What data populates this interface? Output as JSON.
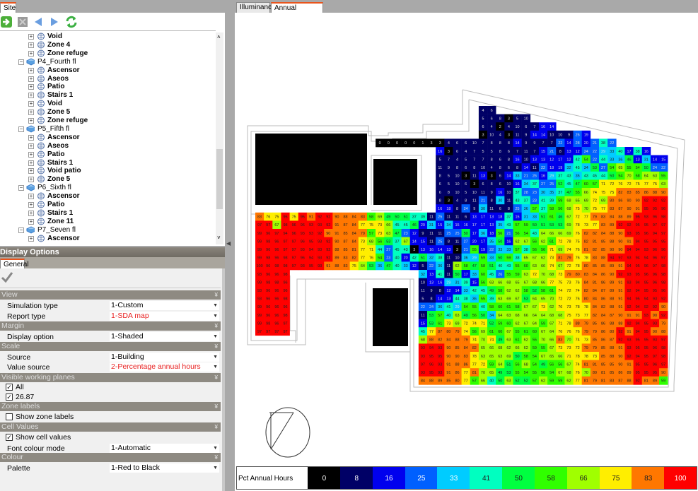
{
  "left_tab": "Site",
  "toolbar_icons": [
    "go-icon",
    "delete-icon",
    "back-icon",
    "forward-icon",
    "refresh-icon"
  ],
  "tree": [
    {
      "level": 2,
      "label": "Void"
    },
    {
      "level": 2,
      "label": "Zone 4"
    },
    {
      "level": 2,
      "label": "Zone refuge"
    },
    {
      "level": 1,
      "label": "P4_Fourth fl"
    },
    {
      "level": 2,
      "label": "Ascensor"
    },
    {
      "level": 2,
      "label": "Aseos"
    },
    {
      "level": 2,
      "label": "Patio"
    },
    {
      "level": 2,
      "label": "Stairs  1"
    },
    {
      "level": 2,
      "label": "Void"
    },
    {
      "level": 2,
      "label": "Zone 5"
    },
    {
      "level": 2,
      "label": "Zone refuge"
    },
    {
      "level": 1,
      "label": "P5_Fifth fl"
    },
    {
      "level": 2,
      "label": "Ascensor"
    },
    {
      "level": 2,
      "label": "Aseos"
    },
    {
      "level": 2,
      "label": "Patio"
    },
    {
      "level": 2,
      "label": "Stairs  1"
    },
    {
      "level": 2,
      "label": "Void patio"
    },
    {
      "level": 2,
      "label": "Zone 5"
    },
    {
      "level": 1,
      "label": "P6_Sixth fl"
    },
    {
      "level": 2,
      "label": "Ascensor"
    },
    {
      "level": 2,
      "label": "Patio"
    },
    {
      "level": 2,
      "label": "Stairs  1"
    },
    {
      "level": 2,
      "label": "Zone 11"
    },
    {
      "level": 1,
      "label": "P7_Seven fl"
    },
    {
      "level": 2,
      "label": "Ascensor"
    }
  ],
  "display_options": {
    "title": "Display Options",
    "tab": "General",
    "sections": {
      "view": "View",
      "margin": "Margin",
      "scale": "Scale",
      "planes": "Visible working planes",
      "zone_labels": "Zone labels",
      "cell_values": "Cell Values",
      "colour": "Colour"
    },
    "simulation_type": {
      "label": "Simulation type",
      "value": "1-Custom"
    },
    "report_type": {
      "label": "Report type",
      "value": "1-SDA map"
    },
    "display_option": {
      "label": "Display option",
      "value": "1-Shaded"
    },
    "source": {
      "label": "Source",
      "value": "1-Building"
    },
    "value_source": {
      "label": "Value source",
      "value": "2-Percentage annual hours"
    },
    "plane_all": {
      "label": "All",
      "checked": true
    },
    "plane_2687": {
      "label": "26.87",
      "checked": true
    },
    "show_zone_labels": {
      "label": "Show zone labels",
      "checked": false
    },
    "show_cell_values": {
      "label": "Show cell values",
      "checked": true
    },
    "font_colour_mode": {
      "label": "Font colour mode",
      "value": "1-Automatic"
    },
    "palette": {
      "label": "Palette",
      "value": "1-Red to Black"
    }
  },
  "main_tabs": [
    {
      "label": "Illuminance",
      "active": false
    },
    {
      "label": "Annual daylighting",
      "active": true
    }
  ],
  "chart_data": {
    "type": "heatmap",
    "legend_title": "Pct Annual Hours",
    "legend": [
      {
        "value": "0",
        "color": "#000000"
      },
      {
        "value": "8",
        "color": "#000066"
      },
      {
        "value": "16",
        "color": "#0000ee"
      },
      {
        "value": "25",
        "color": "#0060ff"
      },
      {
        "value": "33",
        "color": "#00ccff"
      },
      {
        "value": "41",
        "color": "#00ffc0"
      },
      {
        "value": "50",
        "color": "#00ff40"
      },
      {
        "value": "58",
        "color": "#30ff00"
      },
      {
        "value": "66",
        "color": "#a0ff00"
      },
      {
        "value": "75",
        "color": "#ffee00"
      },
      {
        "value": "83",
        "color": "#ff7700"
      },
      {
        "value": "100",
        "color": "#ff0000"
      }
    ],
    "rows": [
      [
        [
          26,
          "4 6"
        ]
      ],
      [
        [
          26,
          "5 6 8 3 5 10"
        ]
      ],
      [
        [
          26,
          "6 4 2 4 10 6 7 16 14"
        ]
      ],
      [
        [
          26,
          "3 10 4 3 11 9 14 14 10 10 9 26 19"
        ]
      ],
      [
        [
          14,
          "0 0 0 0 0 1 3 3 4 6 6 10 7 8 8 8 14 9 9 7 7 22 14 28 20 21 38 22"
        ]
      ],
      [
        [
          21,
          "16 3 6 4 7 5 5 8 6 7 11 7 15 21 8 13 12 24 22 29 33 40 17 38 16"
        ]
      ],
      [
        [
          21,
          "5 7 4 5 7 7 8 6 8 16 10 13 13 12 17 12 42 54 22 44 33 36 46 13 31 14 15"
        ]
      ],
      [
        [
          21,
          "11 9 8 6 8 10 4 8 6 8 14 11 22 18 19 32 45 34 53 27 54 65 55 54 50 24 22"
        ]
      ],
      [
        [
          21,
          "8 5 10 3 11 13 3 6 14 33 21 26 16 29 37 43 35 43 45 44 50 54 70 58 64 63 55"
        ]
      ],
      [
        [
          21,
          "6 5 10 6 3 6 8 6 10 16 34 37 27 25 52 45 47 60 57 71 72 76 72 75 77 75 63"
        ]
      ],
      [
        [
          21,
          "6 8 10 5 10 11 9 16 10 37 28 23 30 35 37 47 55 66 74 75 75 82 83 85 86 88 90"
        ]
      ],
      [
        [
          21,
          "8 3 4 8 11 21 8 30 11 43 37 23 41 39 59 68 65 69 72 69 80 86 90 90 92 92 92"
        ]
      ],
      [
        [
          21,
          "16 18 8 24 9 30 11 6 8 25 36 57 37 58 56 68 75 70 75 77 83 87 90 91 95 95 96"
        ]
      ],
      [
        [
          0,
          "83 76 75 95 75 95 91 92 92 90 88 84 83 58 69 49 50 51 37 39 11 25 11 11 6 13 17 13 18 37 15 31 33 51 61 46 67 72 77 79 83 84 88 89 95 93 96 98"
        ]
      ],
      [
        [
          0,
          "97 97 67 98 96 96 93 93 92 91 87 84 77 75 73 66 45 45 46 20 31 15 34 15 16 17 17 13 35 43 57 59 50 51 53 53 69 78 73 77 83 89 92 92 95 95 97 97"
        ]
      ],
      [
        [
          0,
          "99 96 97 94 96 93 93 92 90 91 85 84 79 57 73 63 47 23 12 9 11 11 25 25 50 17 36 18 56 21 56 54 43 64 66 66 69 76 82 82 84 88 90 93 95 96 94 97"
        ]
      ],
      [
        [
          0,
          "99 98 96 97 97 96 95 93 92 90 87 84 73 68 56 53 37 67 14 15 11 25 8 11 27 20 17 35 50 16 62 67 56 62 61 72 78 75 82 81 85 88 90 91 94 95 95 95"
        ]
      ],
      [
        [
          0,
          "99 96 96 97 97 93 94 93 92 88 85 81 77 71 44 27 45 43 3 13 16 14 13 3 21 55 19 22 33 33 57 38 56 56 71 69 74 76 81 82 85 90 90 94 94 93 96 96"
        ]
      ],
      [
        [
          0,
          "99 98 96 98 97 96 94 93 92 89 83 82 77 76 54 23 40 20 42 51 32 38 11 10 36 29 59 33 50 59 38 65 67 62 73 81 79 76 78 83 88 94 97 93 94 94 96 97"
        ]
      ],
      [
        [
          0,
          "100 96 98 98 97 93 95 93 91 88 83 75 64 53 36 47 40 33 12 5 22 36 11 62 58 47 58 51 40 43 55 60 63 66 74 67 72 78 80 85 85 89 91 94 95 96 97 98"
        ]
      ],
      [
        [
          0,
          "93 96 96 98"
        ],
        [
          19,
          "32 13 41 11 50 17 33 60 45 26 55 59 63 72 70 68 73 79 80 83 84 86 90 92 93 95 96 96 98"
        ]
      ],
      [
        [
          0,
          "99 98 98 96"
        ],
        [
          19,
          "10 13 16 29 31 39 15 56 63 66 68 65 67 68 66 77 75 73 76 84 81 86 89 91 93 94 95 96 98"
        ]
      ],
      [
        [
          0,
          "93 96 96 96"
        ],
        [
          19,
          "11 9 8 12 14 33 42 45 49 58 62 62 58 52 58 61 74 72 74 82 84 87 89 91 92 94 95 95 96"
        ]
      ],
      [
        [
          0,
          "93 96 96 98"
        ],
        [
          19,
          "5 8 14 13 44 38 36 55 39 63 69 67 53 64 65 70 72 72 76 80 84 86 88 91 94 95 94 93 92"
        ]
      ],
      [
        [
          0,
          "99 96 96 96"
        ],
        [
          19,
          "22 24 36 41 29 54 55 40 58 60 61 58 67 67 73 62 76 73 78 78 84 82 88 91 92 94 92 92 90"
        ]
      ],
      [
        [
          0,
          "99 96 96 98"
        ],
        [
          19,
          "11 53 57 40 63 49 56 50 34 64 63 68 66 64 64 68 68 75 73 77 82 84 87 90 91 91 93 90 92"
        ]
      ],
      [
        [
          0,
          "99 98 96 97"
        ],
        [
          19,
          "15 53 61 73 69 72 74 71 52 59 60 62 67 64 59 67 71 78 88 79 85 86 88 88 92 94 95 93 79"
        ]
      ],
      [
        [
          0,
          "97 97 97 97"
        ],
        [
          19,
          "45 77 87 80 79 74 56 69 61 60 67 55 61 60 67 64 76 76 76 79 79 86 80 92 91 94 95 90 88"
        ]
      ],
      [
        [
          19,
          "68 88 82 84 88 79 74 70 74 49 63 61 62 55 70 66 83 70 74 73 85 86 87 92 93 95 95 93 97"
        ]
      ],
      [
        [
          19,
          "93 94 93 90 85 84 82 65 66 68 62 66 62 59 55 67 73 73 72 79 79 85 88 91 93 95 95 96 98"
        ]
      ],
      [
        [
          19,
          "93 95 95 90 90 83 78 63 65 63 69 50 58 54 67 65 66 71 78 78 73 85 88 90 92 94 95 97 98"
        ]
      ],
      [
        [
          19,
          "97 96 93 91 88 86 77 72 59 64 51 56 68 54 49 56 56 67 74 81 81 85 85 90 91 95 95 96 97"
        ]
      ],
      [
        [
          19,
          "93 95 93 91 86 77 81 70 65 49 53 55 54 55 56 54 67 68 76 70 80 81 85 86 89 95 95 95 90"
        ]
      ],
      [
        [
          19,
          "84 88 89 85 80 77 57 66 40 50 63 52 52 57 62 59 59 62 77 81 79 81 83 87 88 92 81 89 59"
        ]
      ]
    ]
  }
}
